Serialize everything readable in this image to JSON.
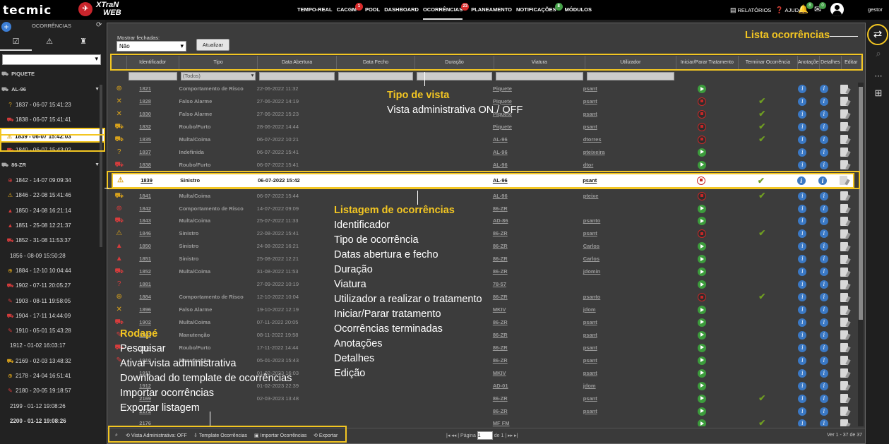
{
  "topbar": {
    "brand": {
      "tecmic": "tecmic",
      "xtran": "XTraN",
      "web": "WEB"
    },
    "nav": [
      {
        "label": "TEMPO-REAL",
        "badge": ""
      },
      {
        "label": "CACGM",
        "badge": "1",
        "badge_color": "red"
      },
      {
        "label": "POOL",
        "badge": ""
      },
      {
        "label": "DASHBOARD",
        "badge": ""
      },
      {
        "label": "OCORRÊNCIAS",
        "badge": "23",
        "badge_color": "red",
        "active": true
      },
      {
        "label": "PLANEAMENTO",
        "badge": ""
      },
      {
        "label": "NOTIFICAÇÕES",
        "badge": "8",
        "badge_color": "green"
      },
      {
        "label": "MÓDULOS",
        "badge": ""
      }
    ],
    "tools": {
      "reports": "RELATÓRIOS",
      "help": "AJUDA"
    },
    "bell_badge": "8",
    "mail_badge": "0",
    "user": "gestor"
  },
  "sidebar": {
    "title": "OCORRÊNCIAS",
    "groups": [
      {
        "name": "PIQUETE",
        "caret": "",
        "items": []
      },
      {
        "name": "AL-96",
        "caret": "▼",
        "items": [
          {
            "text": "1837 - 06-07 15:41:23",
            "icon": "?",
            "color": "y"
          },
          {
            "text": "1838 - 06-07 15:41:41",
            "icon": "⛟",
            "color": "r"
          },
          {
            "text": "1839 - 06-07 15:42:03",
            "icon": "⚠",
            "color": "y",
            "selected": true
          },
          {
            "text": "1840 - 06-07 15:43:02",
            "icon": "⛟",
            "color": "r"
          }
        ]
      },
      {
        "name": "86-ZR",
        "caret": "▼",
        "items": [
          {
            "text": "1842 - 14-07 09:09:34",
            "icon": "⊕",
            "color": "r"
          },
          {
            "text": "1846 - 22-08 15:41:46",
            "icon": "⚠",
            "color": "y"
          },
          {
            "text": "1850 - 24-08 16:21:14",
            "icon": "▲",
            "color": "r"
          },
          {
            "text": "1851 - 25-08 12:21:37",
            "icon": "▲",
            "color": "r"
          },
          {
            "text": "1852 - 31-08 11:53:37",
            "icon": "⛟",
            "color": "r"
          },
          {
            "text": "1856 - 08-09 15:50:28",
            "icon": "",
            "color": "",
            "plain": true
          },
          {
            "text": "1884 - 12-10 10:04:44",
            "icon": "⊕",
            "color": "y"
          },
          {
            "text": "1902 - 07-11 20:05:27",
            "icon": "⛟",
            "color": "r"
          },
          {
            "text": "1903 - 08-11 19:58:05",
            "icon": "✎",
            "color": "r"
          },
          {
            "text": "1904 - 17-11 14:44:09",
            "icon": "⛟",
            "color": "r"
          },
          {
            "text": "1910 - 05-01 15:43:28",
            "icon": "✎",
            "color": "r"
          },
          {
            "text": "1912 - 01-02 16:03:17",
            "icon": "",
            "color": "",
            "plain": true
          },
          {
            "text": "2169 - 02-03 13:48:32",
            "icon": "⛟",
            "color": "y"
          },
          {
            "text": "2178 - 24-04 16:51:41",
            "icon": "⊕",
            "color": "y"
          },
          {
            "text": "2180 - 20-05 19:18:57",
            "icon": "✎",
            "color": "r"
          },
          {
            "text": "2199 - 01-12 19:08:26",
            "icon": "",
            "color": "",
            "plain": true
          },
          {
            "text": "2200 - 01-12 19:08:26",
            "icon": "",
            "color": "",
            "plain": true,
            "bold": true
          }
        ]
      }
    ]
  },
  "filters": {
    "show_closed_label": "Mostrar fechadas:",
    "show_closed_value": "Não",
    "update_button": "Atualizar",
    "type_filter": "(Todos)"
  },
  "table": {
    "columns": [
      "Identificador",
      "Tipo",
      "Data Abertura",
      "Data Fecho",
      "Duração",
      "Viatura",
      "Utilizador",
      "Iniciar/Parar Tratamento",
      "Terminar Ocorrência",
      "Anotações",
      "Detalhes",
      "Editar"
    ],
    "rows": [
      {
        "id": "1821",
        "type": "Comportamento de Risco",
        "opened": "22-06-2022 11:32",
        "vehicle": "Piquete",
        "user": "psant",
        "action": "play",
        "done": false,
        "icon": "⊕",
        "color": "y"
      },
      {
        "id": "1828",
        "type": "Falso Alarme",
        "opened": "27-06-2022 14:19",
        "vehicle": "Piquete",
        "user": "psant",
        "action": "stop",
        "done": true,
        "icon": "✕",
        "color": "y"
      },
      {
        "id": "1830",
        "type": "Falso Alarme",
        "opened": "27-06-2022 15:23",
        "vehicle": "Piquete",
        "user": "psant",
        "action": "stop",
        "done": true,
        "icon": "✕",
        "color": "y"
      },
      {
        "id": "1832",
        "type": "Roubo/Furto",
        "opened": "28-06-2022 14:44",
        "vehicle": "Piquete",
        "user": "psant",
        "action": "stop",
        "done": true,
        "icon": "⛟",
        "color": "y"
      },
      {
        "id": "1835",
        "type": "Multa/Coima",
        "opened": "06-07-2022 10:21",
        "vehicle": "AL-96",
        "user": "dtorres",
        "action": "stop",
        "done": true,
        "icon": "⛟",
        "color": "y"
      },
      {
        "id": "1837",
        "type": "Indefinida",
        "opened": "06-07-2022 15:41",
        "vehicle": "AL-96",
        "user": "pteixeira",
        "action": "play",
        "done": false,
        "icon": "?",
        "color": "y"
      },
      {
        "id": "1838",
        "type": "Roubo/Furto",
        "opened": "06-07-2022 15:41",
        "vehicle": "AL-96",
        "user": "dtor",
        "action": "play",
        "done": false,
        "icon": "⛟",
        "color": "r"
      },
      {
        "id": "1839",
        "type": "Sinistro",
        "opened": "06-07-2022 15:42",
        "vehicle": "AL-96",
        "user": "psant",
        "action": "stop",
        "done": true,
        "icon": "⚠",
        "color": "y",
        "highlight": true
      },
      {
        "id": "1841",
        "type": "Multa/Coima",
        "opened": "06-07-2022 15:44",
        "vehicle": "AL-96",
        "user": "pteixe",
        "action": "stop",
        "done": true,
        "icon": "⛟",
        "color": "y"
      },
      {
        "id": "1842",
        "type": "Comportamento de Risco",
        "opened": "14-07-2022 09:09",
        "vehicle": "86-ZR",
        "user": "",
        "action": "play",
        "done": false,
        "icon": "⊕",
        "color": "r"
      },
      {
        "id": "1843",
        "type": "Multa/Coima",
        "opened": "25-07-2022 11:33",
        "vehicle": "AD-86",
        "user": "psanto",
        "action": "play",
        "done": false,
        "icon": "⛟",
        "color": "r"
      },
      {
        "id": "1846",
        "type": "Sinistro",
        "opened": "22-08-2022 15:41",
        "vehicle": "86-ZR",
        "user": "psant",
        "action": "stop",
        "done": true,
        "icon": "⚠",
        "color": "y"
      },
      {
        "id": "1850",
        "type": "Sinistro",
        "opened": "24-08-2022 16:21",
        "vehicle": "86-ZR",
        "user": "Carlos",
        "action": "play",
        "done": false,
        "icon": "▲",
        "color": "r"
      },
      {
        "id": "1851",
        "type": "Sinistro",
        "opened": "25-08-2022 12:21",
        "vehicle": "86-ZR",
        "user": "Carlos",
        "action": "play",
        "done": false,
        "icon": "▲",
        "color": "r"
      },
      {
        "id": "1852",
        "type": "Multa/Coima",
        "opened": "31-08-2022 11:53",
        "vehicle": "86-ZR",
        "user": "jdomin",
        "action": "play",
        "done": false,
        "icon": "⛟",
        "color": "r"
      },
      {
        "id": "1881",
        "type": "",
        "opened": "27-09-2022 10:19",
        "vehicle": "78-57",
        "user": "",
        "action": "play",
        "done": false,
        "icon": "?",
        "color": "r"
      },
      {
        "id": "1884",
        "type": "Comportamento de Risco",
        "opened": "12-10-2022 10:04",
        "vehicle": "86-ZR",
        "user": "psanto",
        "action": "stop",
        "done": true,
        "icon": "⊕",
        "color": "y"
      },
      {
        "id": "1896",
        "type": "Falso Alarme",
        "opened": "19-10-2022 12:19",
        "vehicle": "MKIV",
        "user": "jdom",
        "action": "play",
        "done": false,
        "icon": "✕",
        "color": "y"
      },
      {
        "id": "1902",
        "type": "Multa/Coima",
        "opened": "07-11-2022 20:05",
        "vehicle": "86-ZR",
        "user": "psant",
        "action": "play",
        "done": false,
        "icon": "⛟",
        "color": "r"
      },
      {
        "id": "1903",
        "type": "Manutenção",
        "opened": "08-11-2022 19:58",
        "vehicle": "86-ZR",
        "user": "psant",
        "action": "play",
        "done": false,
        "icon": "✎",
        "color": "r"
      },
      {
        "id": "1904",
        "type": "Roubo/Furto",
        "opened": "17-11-2022 14:44",
        "vehicle": "86-ZR",
        "user": "psant",
        "action": "play",
        "done": false,
        "icon": "⛟",
        "color": "r"
      },
      {
        "id": "1910",
        "type": "Manutenção",
        "opened": "05-01-2023 15:43",
        "vehicle": "86-ZR",
        "user": "psant",
        "action": "play",
        "done": false,
        "icon": "✎",
        "color": "r"
      },
      {
        "id": "1911",
        "type": "",
        "opened": "01-02-2023 16:03",
        "vehicle": "MKIV",
        "user": "psant",
        "action": "play",
        "done": false,
        "icon": "",
        "color": "r"
      },
      {
        "id": "1912",
        "type": "",
        "opened": "01-02-2023 22:39",
        "vehicle": "AD-01",
        "user": "jdom",
        "action": "play",
        "done": false,
        "icon": "",
        "color": "r"
      },
      {
        "id": "2169",
        "type": "",
        "opened": "02-03-2023 13:48",
        "vehicle": "86-ZR",
        "user": "psant",
        "action": "play",
        "done": true,
        "icon": "",
        "color": "y"
      },
      {
        "id": "2172",
        "type": "",
        "opened": "",
        "vehicle": "86-ZR",
        "user": "psant",
        "action": "play",
        "done": false,
        "icon": "",
        "color": "r"
      },
      {
        "id": "2176",
        "type": "",
        "opened": "",
        "vehicle": "MF FM",
        "user": "",
        "action": "play",
        "done": true,
        "icon": "",
        "color": "y"
      }
    ]
  },
  "footer": {
    "search_icon": "search-icon",
    "admin_view": "Vista Administrativa: OFF",
    "template": "Template Ocorrências",
    "import": "Importar Ocorrências",
    "export": "Exportar",
    "page_label": "Página",
    "page_value": "1",
    "page_of": "de 1",
    "records": "Ver 1 - 37 de 37"
  },
  "annotations": {
    "list": "Lista ocorrências",
    "view_title": "Tipo de vista",
    "view_lines": [
      "Vista administrativa ON / OFF"
    ],
    "listing_title": "Listagem de ocorrências",
    "listing_lines": [
      "Identificador",
      "Tipo de ocorrência",
      "Datas abertura e fecho",
      "Duração",
      "Viatura",
      "Utilizador a realizar o tratamento",
      "Iniciar/Parar tratamento",
      "Ocorrências terminadas",
      "Anotações",
      "Detalhes",
      "Edição"
    ],
    "footer_title": "Rodapé",
    "footer_lines": [
      "Pesquisar",
      "Ativar vista administrativa",
      "Download do template de ocorrências",
      "Importar ocorrências",
      "Exportar listagem"
    ]
  },
  "colors": {
    "accent": "#f3c622",
    "play": "#3c9c3c",
    "stop": "#c82727",
    "info": "#3a78c4",
    "check": "#6f9d22"
  }
}
